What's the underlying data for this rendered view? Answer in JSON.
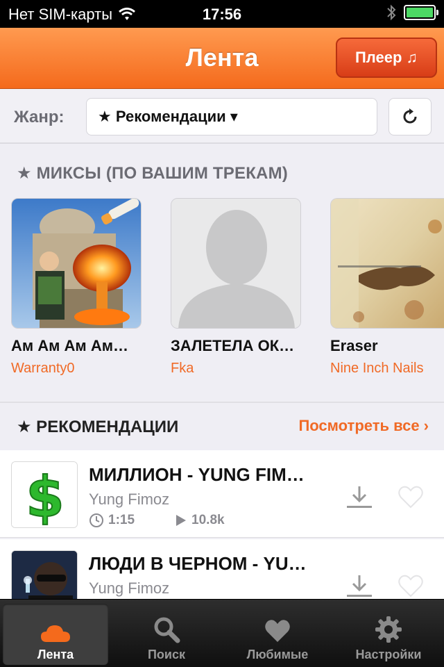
{
  "status_bar": {
    "carrier": "Нет SIM-карты",
    "time": "17:56"
  },
  "navbar": {
    "title": "Лента",
    "player_button": "Плеер ♫"
  },
  "genre": {
    "label": "Жанр:",
    "selected": "★ Рекомендации ▾"
  },
  "mixes": {
    "title": "★ МИКСЫ (ПО ВАШИМ ТРЕКАМ)",
    "items": [
      {
        "title": "Ам Ам Ам Ам…",
        "artist": "Warranty0"
      },
      {
        "title": "ЗАЛЕТЕЛА ОК…",
        "artist": "Fka"
      },
      {
        "title": "Eraser",
        "artist": "Nine Inch Nails"
      }
    ]
  },
  "recommendations": {
    "title": "★ РЕКОМЕНДАЦИИ",
    "see_all": "Посмотреть все ›",
    "tracks": [
      {
        "title": "МИЛЛИОН - YUNG FIM…",
        "artist": "Yung Fimoz",
        "duration": "1:15",
        "plays": "10.8k"
      },
      {
        "title": "ЛЮДИ В ЧЕРНОМ  - YU…",
        "artist": "Yung Fimoz"
      }
    ]
  },
  "tabs": [
    {
      "label": "Лента",
      "active": true
    },
    {
      "label": "Поиск",
      "active": false
    },
    {
      "label": "Любимые",
      "active": false
    },
    {
      "label": "Настройки",
      "active": false
    }
  ],
  "colors": {
    "accent": "#f06a26",
    "navbar_top": "#ff9a50",
    "navbar_bottom": "#f46a1c",
    "battery": "#4cd964"
  }
}
